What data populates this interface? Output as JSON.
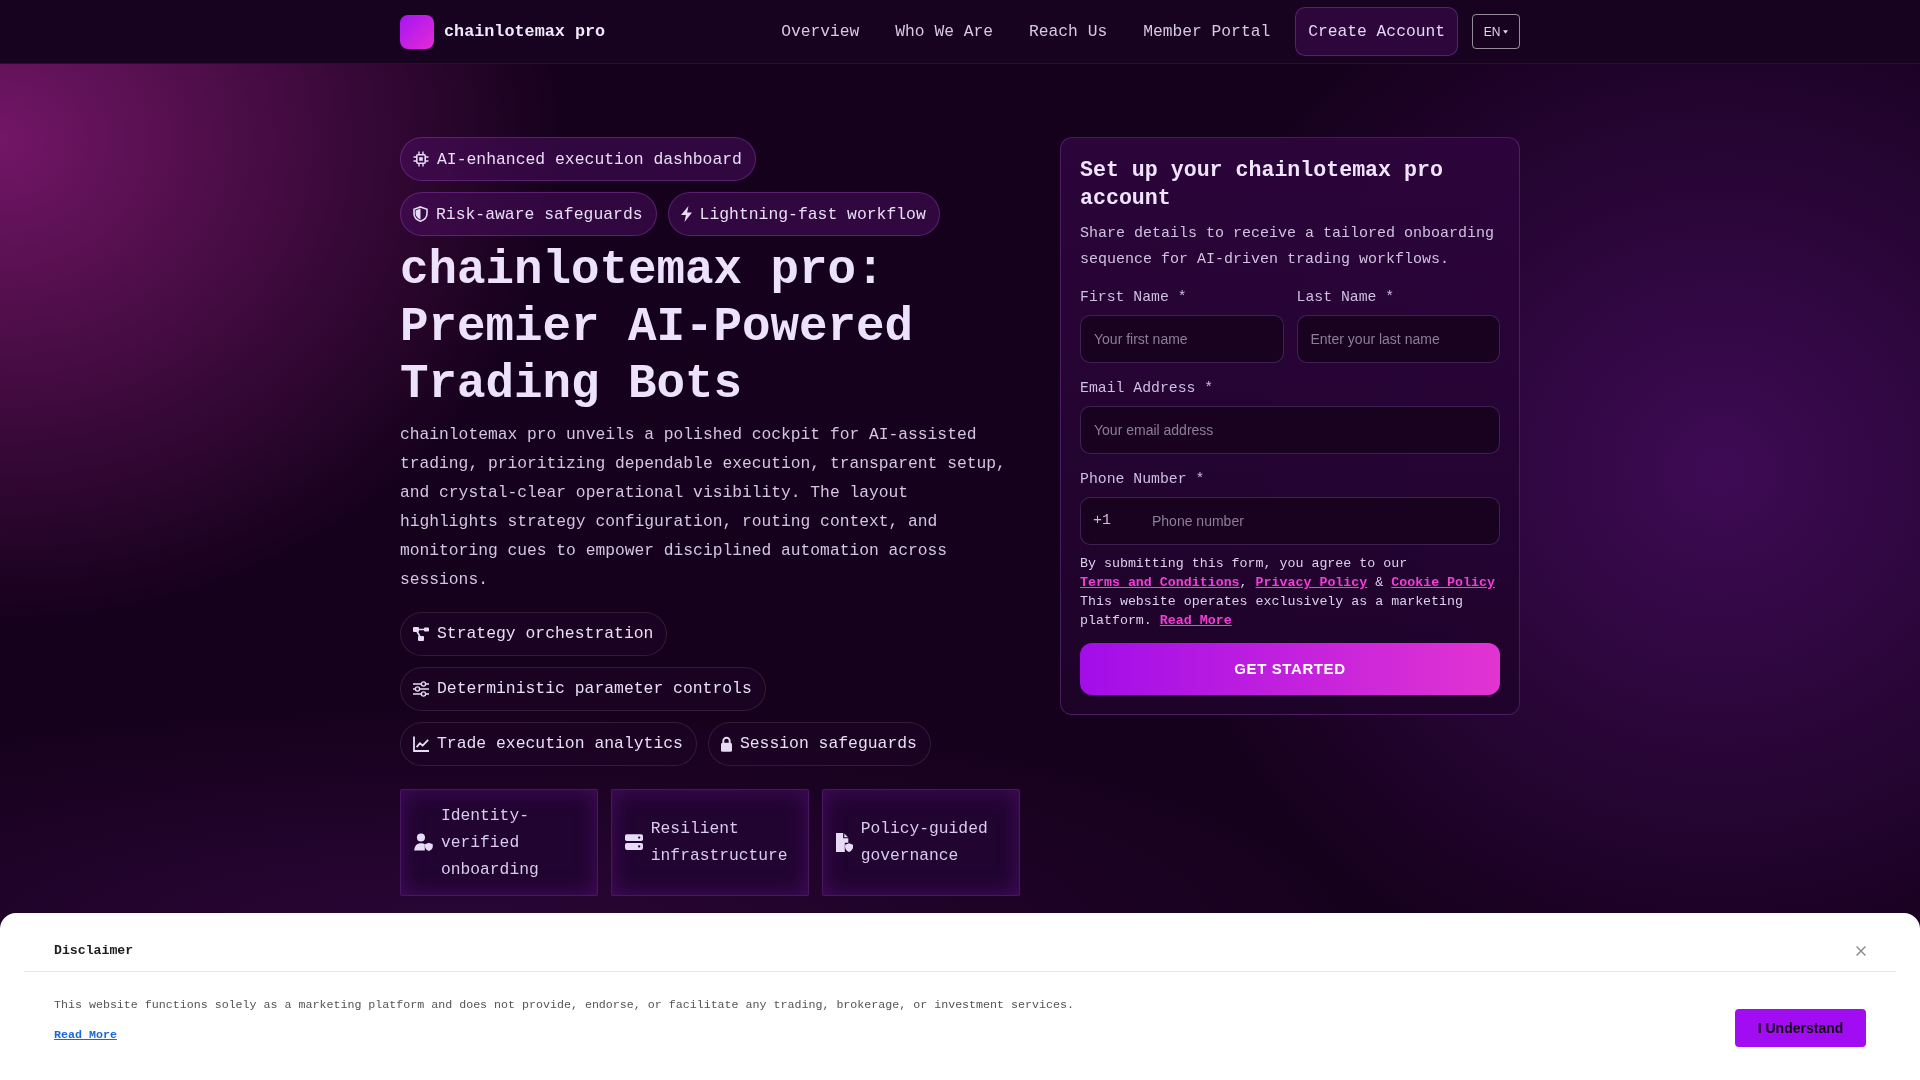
{
  "header": {
    "brand": "chainlotemax pro",
    "nav": [
      {
        "label": "Overview"
      },
      {
        "label": "Who We Are"
      },
      {
        "label": "Reach Us"
      },
      {
        "label": "Member Portal"
      }
    ],
    "cta": "Create Account",
    "language": "EN"
  },
  "hero": {
    "badges": [
      "AI-enhanced execution dashboard",
      "Risk-aware safeguards",
      "Lightning-fast workflow"
    ],
    "title": "chainlotemax pro: Premier AI-Powered Trading Bots",
    "description": "chainlotemax pro unveils a polished cockpit for AI-assisted trading, prioritizing dependable execution, transparent setup, and crystal-clear operational visibility. The layout highlights strategy configuration, routing context, and monitoring cues to empower disciplined automation across sessions.",
    "features": [
      "Strategy orchestration",
      "Deterministic parameter controls",
      "Trade execution analytics",
      "Session safeguards"
    ],
    "cards": [
      "Identity-verified onboarding",
      "Resilient infrastructure",
      "Policy-guided governance"
    ]
  },
  "signup": {
    "title": "Set up your chainlotemax pro account",
    "description": "Share details to receive a tailored onboarding sequence for AI-driven trading workflows.",
    "rows": [
      [
        {
          "kind": "text",
          "label": "First Name *",
          "placeholder": "Your first name"
        },
        {
          "kind": "text",
          "label": "Last Name *",
          "placeholder": "Enter your last name"
        }
      ],
      [
        {
          "kind": "email",
          "label": "Email Address *",
          "placeholder": "Your email address"
        }
      ],
      [
        {
          "kind": "phone",
          "label": "Phone Number *",
          "prefix": "+1",
          "placeholder": "Phone number"
        }
      ]
    ],
    "consent": [
      {
        "kind": "text",
        "text": "By submitting this form, you agree to our "
      },
      {
        "kind": "link",
        "text": "Terms and Conditions"
      },
      {
        "kind": "text",
        "text": ", "
      },
      {
        "kind": "link",
        "text": "Privacy Policy"
      },
      {
        "kind": "text",
        "text": " & "
      },
      {
        "kind": "link",
        "text": "Cookie Policy"
      },
      {
        "kind": "text",
        "text": " This website operates exclusively as a marketing platform. "
      },
      {
        "kind": "link",
        "text": "Read More"
      }
    ],
    "submit": "GET STARTED"
  },
  "disclaimer": {
    "title": "Disclaimer",
    "text": "This website functions solely as a marketing platform and does not provide, endorse, or facilitate any trading, brokerage, or investment services.",
    "link": "Read More",
    "button": "I Understand"
  }
}
